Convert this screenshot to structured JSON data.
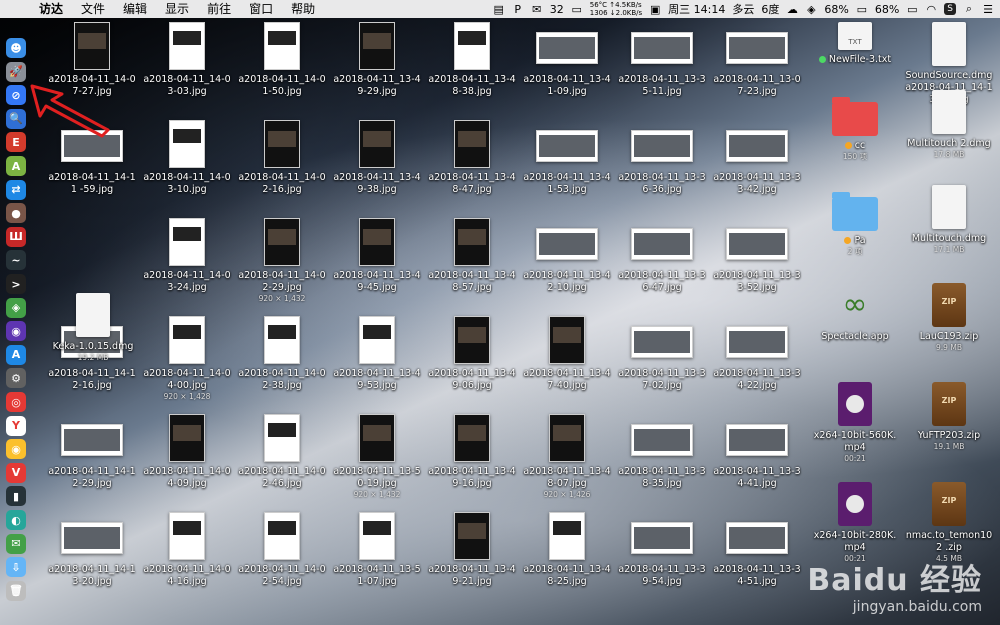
{
  "menubar": {
    "menus": [
      "访达",
      "文件",
      "编辑",
      "显示",
      "前往",
      "窗口",
      "帮助"
    ],
    "status": {
      "wechat_count": "32",
      "net_up": "56°C ↑4.5KB/s",
      "net_down": "1306 ↓2.0KB/s",
      "date_time": "周三 14:14",
      "weather": "多云",
      "weather_temp": "6度",
      "battery_1": "68%",
      "battery_2": "68%"
    }
  },
  "dock": {
    "items": [
      {
        "name": "finder-icon",
        "color": "#3a8ee6",
        "glyph": "☻"
      },
      {
        "name": "launchpad-icon",
        "color": "#8a8f98",
        "glyph": "🚀"
      },
      {
        "name": "safari-icon",
        "color": "#3478f6",
        "glyph": "⊘"
      },
      {
        "name": "preview-icon",
        "color": "#2f6fd6",
        "glyph": "🔍"
      },
      {
        "name": "app-red-icon",
        "color": "#d33b2c",
        "glyph": "E"
      },
      {
        "name": "android-icon",
        "color": "#7cb342",
        "glyph": "A"
      },
      {
        "name": "teamviewer-icon",
        "color": "#1e88e5",
        "glyph": "⇄"
      },
      {
        "name": "app-brown-icon",
        "color": "#795548",
        "glyph": "●"
      },
      {
        "name": "app-bars-icon",
        "color": "#c62828",
        "glyph": "Ш"
      },
      {
        "name": "activity-icon",
        "color": "#263238",
        "glyph": "~"
      },
      {
        "name": "terminal-icon",
        "color": "#212121",
        "glyph": ">"
      },
      {
        "name": "maps-icon",
        "color": "#43a047",
        "glyph": "◈"
      },
      {
        "name": "siri-icon",
        "color": "#5e35b1",
        "glyph": "◉"
      },
      {
        "name": "appstore-icon",
        "color": "#1e88e5",
        "glyph": "A"
      },
      {
        "name": "settings-icon",
        "color": "#616161",
        "glyph": "⚙"
      },
      {
        "name": "netease-music-icon",
        "color": "#e53935",
        "glyph": "◎"
      },
      {
        "name": "yandex-icon",
        "color": "#ffffff",
        "glyph": "Y"
      },
      {
        "name": "chrome-icon",
        "color": "#fbc02d",
        "glyph": "◉"
      },
      {
        "name": "vivaldi-icon",
        "color": "#e53935",
        "glyph": "V"
      },
      {
        "name": "terminal2-icon",
        "color": "#263238",
        "glyph": "▮"
      },
      {
        "name": "app-teal-icon",
        "color": "#26a69a",
        "glyph": "◐"
      },
      {
        "name": "wechat-icon",
        "color": "#43a047",
        "glyph": "✉"
      },
      {
        "name": "downloads-folder-icon",
        "color": "#64b5f6",
        "glyph": "⇩"
      },
      {
        "name": "trash-icon",
        "color": "#bdbdbd",
        "glyph": "🗑"
      }
    ]
  },
  "desktop": {
    "files": [
      {
        "cap": "a2018-04-11_14-0 7-27.jpg",
        "kind": "tall dark"
      },
      {
        "cap": "a2018-04-11_14-0 3-03.jpg",
        "kind": "tall"
      },
      {
        "cap": "a2018-04-11_14-0 1-50.jpg",
        "kind": "tall"
      },
      {
        "cap": "a2018-04-11_13-4 9-29.jpg",
        "kind": "tall dark"
      },
      {
        "cap": "a2018-04-11_13-4 8-38.jpg",
        "kind": "tall"
      },
      {
        "cap": "a2018-04-11_13-4 1-09.jpg",
        "kind": "wide"
      },
      {
        "cap": "a2018-04-11_13-3 5-11.jpg",
        "kind": "wide"
      },
      {
        "cap": "a2018-04-11_13-0 7-23.jpg",
        "kind": "wide"
      },
      {
        "cap": "a2018-04-11_14-11 -59.jpg",
        "kind": "wide"
      },
      {
        "cap": "a2018-04-11_14-0 3-10.jpg",
        "kind": "tall"
      },
      {
        "cap": "a2018-04-11_14-0 2-16.jpg",
        "kind": "tall dark"
      },
      {
        "cap": "a2018-04-11_13-4 9-38.jpg",
        "kind": "tall dark"
      },
      {
        "cap": "a2018-04-11_13-4 8-47.jpg",
        "kind": "tall dark"
      },
      {
        "cap": "a2018-04-11_13-4 1-53.jpg",
        "kind": "wide"
      },
      {
        "cap": "a2018-04-11_13-3 6-36.jpg",
        "kind": "wide"
      },
      {
        "cap": "a2018-04-11_13-3 3-42.jpg",
        "kind": "wide"
      },
      {
        "cap": "a2018-04-11_14-0 3-24.jpg",
        "kind": "tall"
      },
      {
        "cap": "a2018-04-11_14-0 2-29.jpg",
        "kind": "tall dark",
        "sub": "920 × 1,432"
      },
      {
        "cap": "a2018-04-11_13-4 9-45.jpg",
        "kind": "tall dark"
      },
      {
        "cap": "a2018-04-11_13-4 8-57.jpg",
        "kind": "tall dark"
      },
      {
        "cap": "a2018-04-11_13-4 2-10.jpg",
        "kind": "wide"
      },
      {
        "cap": "a2018-04-11_13-3 6-47.jpg",
        "kind": "wide"
      },
      {
        "cap": "a2018-04-11_13-3 3-52.jpg",
        "kind": "wide"
      },
      {
        "cap": "a2018-04-11_14-1 2-16.jpg",
        "kind": "wide"
      },
      {
        "cap": "a2018-04-11_14-0 4-00.jpg",
        "kind": "tall",
        "sub": "920 × 1,428"
      },
      {
        "cap": "a2018-04-11_14-0 2-38.jpg",
        "kind": "tall"
      },
      {
        "cap": "a2018-04-11_13-4 9-53.jpg",
        "kind": "tall"
      },
      {
        "cap": "a2018-04-11_13-4 9-06.jpg",
        "kind": "tall dark"
      },
      {
        "cap": "a2018-04-11_13-4 7-40.jpg",
        "kind": "tall dark"
      },
      {
        "cap": "a2018-04-11_13-3 7-02.jpg",
        "kind": "wide"
      },
      {
        "cap": "a2018-04-11_13-3 4-22.jpg",
        "kind": "wide"
      },
      {
        "cap": "a2018-04-11_14-1 2-29.jpg",
        "kind": "wide"
      },
      {
        "cap": "a2018-04-11_14-0 4-09.jpg",
        "kind": "tall dark"
      },
      {
        "cap": "a2018-04-11_14-0 2-46.jpg",
        "kind": "tall"
      },
      {
        "cap": "a2018-04-11_13-5 0-19.jpg",
        "kind": "tall dark",
        "sub": "920 × 1,432"
      },
      {
        "cap": "a2018-04-11_13-4 9-16.jpg",
        "kind": "tall dark"
      },
      {
        "cap": "a2018-04-11_13-4 8-07.jpg",
        "kind": "tall dark",
        "sub": "920 × 1,426"
      },
      {
        "cap": "a2018-04-11_13-3 8-35.jpg",
        "kind": "wide"
      },
      {
        "cap": "a2018-04-11_13-3 4-41.jpg",
        "kind": "wide"
      },
      {
        "cap": "a2018-04-11_14-1 3-20.jpg",
        "kind": "wide"
      },
      {
        "cap": "a2018-04-11_14-0 4-16.jpg",
        "kind": "tall"
      },
      {
        "cap": "a2018-04-11_14-0 2-54.jpg",
        "kind": "tall"
      },
      {
        "cap": "a2018-04-11_13-5 1-07.jpg",
        "kind": "tall"
      },
      {
        "cap": "a2018-04-11_13-4 9-21.jpg",
        "kind": "tall dark"
      },
      {
        "cap": "a2018-04-11_13-4 8-25.jpg",
        "kind": "tall"
      },
      {
        "cap": "a2018-04-11_13-3 9-54.jpg",
        "kind": "wide"
      },
      {
        "cap": "a2018-04-11_13-3 4-51.jpg",
        "kind": "wide"
      }
    ],
    "keka": {
      "cap": "Keka-1.0.15.dmg",
      "sub": "19.2 MB"
    },
    "right_items": [
      {
        "cap": "NewFile-3.txt",
        "kind": "doc",
        "label": "TXT",
        "dot": "green"
      },
      {
        "cap": "SoundSource.dmg a2018-04-11_14-1 3-49.jpg",
        "kind": "doc",
        "label": ""
      },
      {
        "cap": "cc",
        "kind": "folder-red",
        "sub": "150 项",
        "dot": "orange"
      },
      {
        "cap": "Multitouch 2.dmg",
        "kind": "doc",
        "label": "",
        "sub": "17.8 MB"
      },
      {
        "cap": "Pa",
        "kind": "folder-blue",
        "sub": "2 项",
        "dot": "orange"
      },
      {
        "cap": "Multitouch.dmg",
        "kind": "doc",
        "label": "",
        "sub": "17.1 MB"
      },
      {
        "cap": "Spectacle.app",
        "kind": "app"
      },
      {
        "cap": "LauC193.zip",
        "kind": "zip",
        "label": "ZIP",
        "sub": "9.9 MB"
      },
      {
        "cap": "x264-10bit-560K. mp4",
        "kind": "video",
        "sub": "00:21"
      },
      {
        "cap": "YuFTP203.zip",
        "kind": "zip",
        "label": "ZIP",
        "sub": "19.1 MB"
      },
      {
        "cap": "x264-10bit-280K. mp4",
        "kind": "video",
        "sub": "00:21"
      },
      {
        "cap": "nmac.to_temon102 .zip",
        "kind": "zip",
        "label": "ZIP",
        "sub": "4.5 MB"
      }
    ]
  },
  "watermark": {
    "line1": "Baidu 经验",
    "line2": "jingyan.baidu.com"
  }
}
